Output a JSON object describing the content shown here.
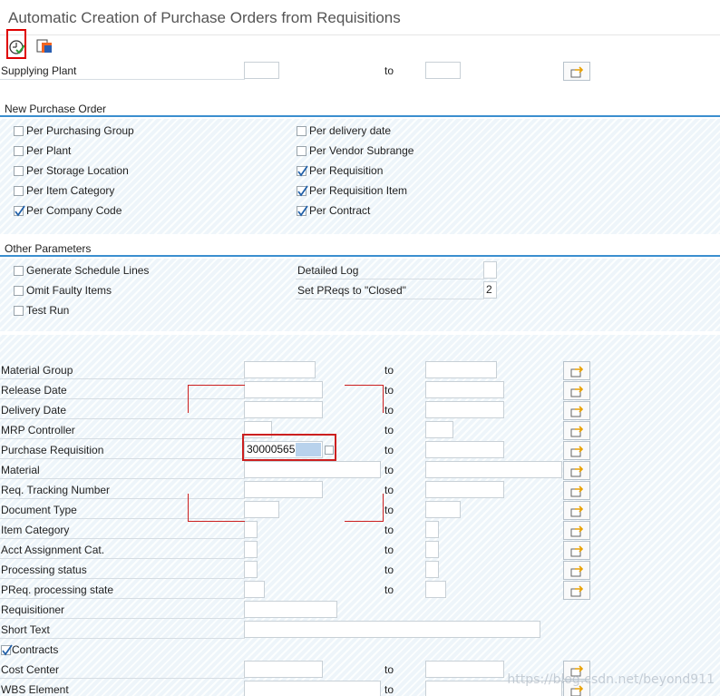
{
  "window": {
    "title": "Automatic Creation of Purchase Orders from Requisitions"
  },
  "top_row": {
    "label": "Supplying Plant",
    "to": "to"
  },
  "section_new_po": {
    "title": "New Purchase Order",
    "left": [
      {
        "label": "Per Purchasing Group",
        "checked": false
      },
      {
        "label": "Per Plant",
        "checked": false
      },
      {
        "label": "Per Storage Location",
        "checked": false
      },
      {
        "label": "Per Item Category",
        "checked": false
      },
      {
        "label": "Per Company Code",
        "checked": true
      }
    ],
    "right": [
      {
        "label": "Per delivery date",
        "checked": false
      },
      {
        "label": "Per Vendor Subrange",
        "checked": false
      },
      {
        "label": "Per Requisition",
        "checked": true
      },
      {
        "label": "Per Requisition Item",
        "checked": true
      },
      {
        "label": "Per Contract",
        "checked": true
      }
    ]
  },
  "section_other": {
    "title": "Other Parameters",
    "checks": [
      {
        "label": "Generate Schedule Lines",
        "checked": false
      },
      {
        "label": "Omit Faulty Items",
        "checked": false
      },
      {
        "label": "Test Run",
        "checked": false
      }
    ],
    "detailed_log": {
      "label": "Detailed Log",
      "value": ""
    },
    "set_closed": {
      "label": "Set PReqs to \"Closed\"",
      "value": "2"
    }
  },
  "selection": {
    "to": "to",
    "rows": [
      {
        "label": "Material Group"
      },
      {
        "label": "Release Date"
      },
      {
        "label": "Delivery Date"
      },
      {
        "label": "MRP Controller"
      },
      {
        "label": "Purchase Requisition",
        "value": "3000056557"
      },
      {
        "label": "Material"
      },
      {
        "label": "Req. Tracking Number"
      },
      {
        "label": "Document Type"
      },
      {
        "label": "Item Category"
      },
      {
        "label": "Acct Assignment Cat."
      },
      {
        "label": "Processing status"
      },
      {
        "label": "PReq. processing state"
      },
      {
        "label": "Requisitioner"
      },
      {
        "label": "Short Text"
      },
      {
        "label": "Contracts"
      },
      {
        "label": "Cost Center"
      },
      {
        "label": "WBS Element"
      }
    ]
  },
  "watermark": "https://blog.csdn.net/beyond911"
}
